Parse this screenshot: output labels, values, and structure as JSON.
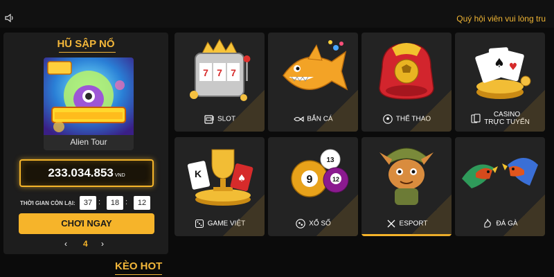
{
  "header": {
    "marquee": "Quý hội viên vui lòng tru"
  },
  "jackpot": {
    "title": "HŨ SẬP NỔ",
    "game_name": "Alien Tour",
    "amount": "233.034.853",
    "currency": "VND",
    "time_label": "THỜI GIAN CÒN LẠI:",
    "time": [
      "37",
      "18",
      "12"
    ],
    "play_label": "CHƠI NGAY",
    "page": "4",
    "prev": "‹",
    "next": "›"
  },
  "categories": [
    {
      "label": "SLOT",
      "icon": "slot-machine-icon"
    },
    {
      "label": "BẮN CÁ",
      "icon": "fish-icon"
    },
    {
      "label": "THỂ THAO",
      "icon": "football-icon"
    },
    {
      "label": "CASINO TRỰC TUYẾN",
      "line1": "CASINO",
      "line2": "TRỰC TUYẾN",
      "icon": "cards-icon"
    },
    {
      "label": "GAME VIỆT",
      "icon": "dice-icon"
    },
    {
      "label": "XỔ SỐ",
      "icon": "lottery-icon"
    },
    {
      "label": "ESPORT",
      "icon": "swords-icon"
    },
    {
      "label": "ĐÁ GÀ",
      "icon": "rooster-icon"
    }
  ],
  "footer": {
    "section_title": "KÈO HOT"
  },
  "colors": {
    "accent": "#f6b42a",
    "background": "#0b0b0b",
    "panel": "#1d1d1d",
    "tile": "#232323"
  }
}
